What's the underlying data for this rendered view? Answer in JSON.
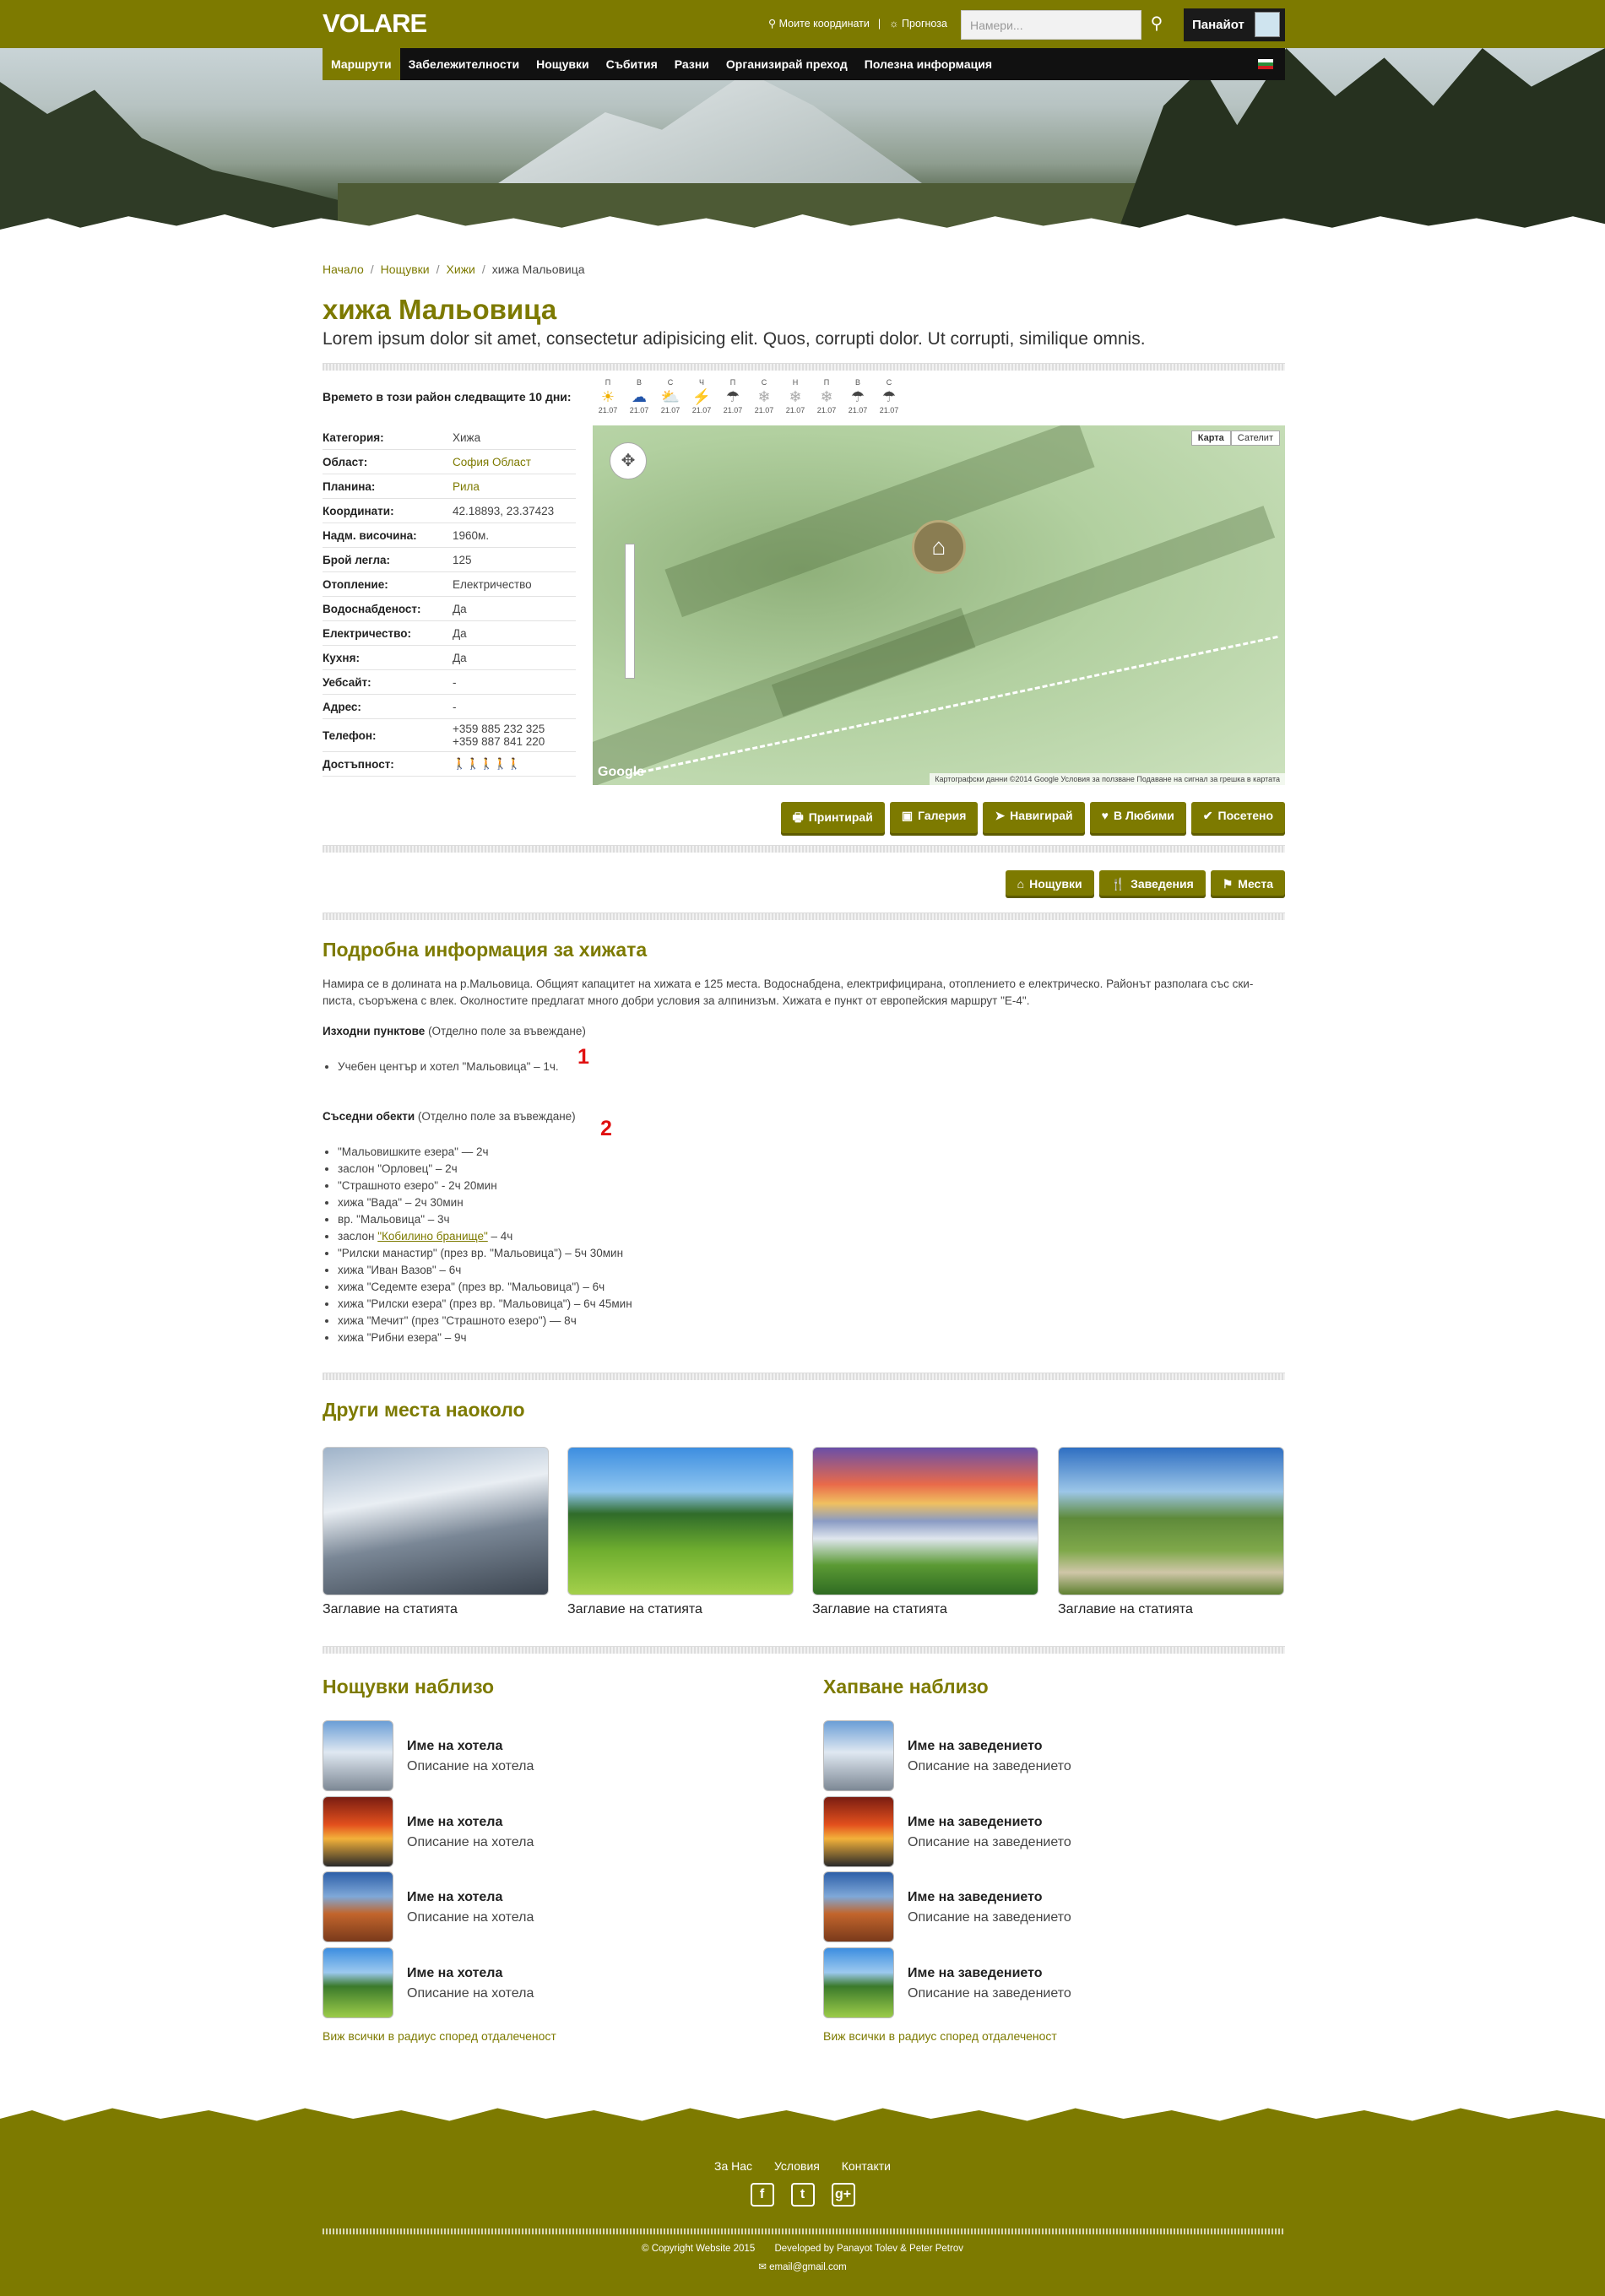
{
  "header": {
    "logo": "VOLARE",
    "my_coords": "⚲ Моите координати",
    "forecast": "☼ Прогноза",
    "separator": "|",
    "search_placeholder": "Намери...",
    "user_name": "Панайот"
  },
  "nav": {
    "items": [
      {
        "label": "Маршрути",
        "active": true
      },
      {
        "label": "Забележителности",
        "active": false
      },
      {
        "label": "Нощувки",
        "active": false
      },
      {
        "label": "Събития",
        "active": false
      },
      {
        "label": "Разни",
        "active": false
      },
      {
        "label": "Организирай преход",
        "active": false
      },
      {
        "label": "Полезна информация",
        "active": false
      }
    ]
  },
  "breadcrumb": [
    "Начало",
    "Нощувки",
    "Хижи",
    "хижа Мальовица"
  ],
  "page": {
    "title": "хижа Мальовица",
    "subtitle": "Lorem ipsum dolor sit amet, consectetur adipisicing elit. Quos, corrupti dolor. Ut corrupti, similique omnis."
  },
  "weather": {
    "label": "Времето в този район следващите 10 дни:",
    "days": [
      {
        "day": "П",
        "icon": "sun-icon",
        "glyph": "☀",
        "color": "#f0b000",
        "date": "21.07"
      },
      {
        "day": "В",
        "icon": "cloud-icon",
        "glyph": "☁",
        "color": "#2255aa",
        "date": "21.07"
      },
      {
        "day": "С",
        "icon": "sun-cloud-icon",
        "glyph": "⛅",
        "color": "#33aacc",
        "date": "21.07"
      },
      {
        "day": "Ч",
        "icon": "lightning-icon",
        "glyph": "⚡",
        "color": "#dd1111",
        "date": "21.07"
      },
      {
        "day": "П",
        "icon": "rain-icon",
        "glyph": "☂",
        "color": "#444444",
        "date": "21.07"
      },
      {
        "day": "С",
        "icon": "snow-icon",
        "glyph": "❄",
        "color": "#aaaaaa",
        "date": "21.07"
      },
      {
        "day": "Н",
        "icon": "snow-icon",
        "glyph": "❄",
        "color": "#aaaaaa",
        "date": "21.07"
      },
      {
        "day": "П",
        "icon": "snow-icon",
        "glyph": "❄",
        "color": "#aaaaaa",
        "date": "21.07"
      },
      {
        "day": "В",
        "icon": "rain-icon",
        "glyph": "☂",
        "color": "#444444",
        "date": "21.07"
      },
      {
        "day": "С",
        "icon": "rain-icon",
        "glyph": "☂",
        "color": "#444444",
        "date": "21.07"
      }
    ]
  },
  "properties": [
    {
      "k": "Категория:",
      "v": "Хижа"
    },
    {
      "k": "Област:",
      "v": "София Област",
      "link": true
    },
    {
      "k": "Планина:",
      "v": "Рила",
      "link": true
    },
    {
      "k": "Координати:",
      "v": "42.18893, 23.37423"
    },
    {
      "k": "Надм. височина:",
      "v": "1960м."
    },
    {
      "k": "Брой легла:",
      "v": "125"
    },
    {
      "k": "Отопление:",
      "v": "Електричество"
    },
    {
      "k": "Водоснабденост:",
      "v": "Да"
    },
    {
      "k": "Електричество:",
      "v": "Да"
    },
    {
      "k": "Кухня:",
      "v": "Да"
    },
    {
      "k": "Уебсайт:",
      "v": "-"
    },
    {
      "k": "Адрес:",
      "v": "-"
    },
    {
      "k": "Телефон:",
      "v": "+359 885 232 325\n+359 887 841 220"
    },
    {
      "k": "Достъпност:",
      "v": ""
    }
  ],
  "accessibility_rating": 4,
  "accessibility_max": 5,
  "map": {
    "tab_map": "Карта",
    "tab_sat": "Сателит",
    "google": "Google",
    "footer": "Картографски данни ©2014 Google   Условия за ползване   Подаване на сигнал за грешка в картата"
  },
  "actions": [
    "Принтирай",
    "Галерия",
    "Навигирай",
    "В Любими",
    "Посетено"
  ],
  "action_icons": [
    "🖶",
    "▣",
    "➤",
    "♥",
    "✔"
  ],
  "filters": [
    "Нощувки",
    "Заведения",
    "Места"
  ],
  "filter_icons": [
    "⌂",
    "🍴",
    "⚑"
  ],
  "info": {
    "heading": "Подробна информация за хижата",
    "text": "Намира се в долината на р.Мальовица. Общият капацитет на хижата е 125 места. Водоснабдена, електрифицирана, отоплението е електрическо. Районът разполага със ски-писта, съоръжена с влек. Околностите предлагат много добри условия за алпинизъм. Хижата е пункт от европейския маршрут \"Е-4\".",
    "start_label": "Изходни пунктове",
    "start_note": " (Отделно поле за въвеждане)",
    "start_items": [
      "Учебен център и хотел \"Мальовица\" – 1ч."
    ],
    "neighbors_label": "Съседни обекти",
    "neighbors_note": " (Отделно поле за въвеждане)",
    "neighbors": [
      "\"Мальовишките езера\" — 2ч",
      "заслон \"Орловец\" – 2ч",
      "\"Страшното езеро\" - 2ч 20мин",
      "хижа \"Вада\" – 2ч 30мин",
      "вр. \"Мальовица\" – 3ч",
      "заслон ",
      "\"Рилски манастир\" (през вр. \"Мальовица\") – 5ч 30мин",
      "хижа \"Иван Вазов\" – 6ч",
      "хижа \"Седемте езера\" (през вр. \"Мальовица\") – 6ч",
      "хижа \"Рилски езера\" (през вр. \"Мальовица\") – 6ч 45мин",
      "хижа \"Мечит\" (през \"Страшното езеро\") — 8ч",
      "хижа \"Рибни езера\" – 9ч"
    ],
    "neighbor_link": "\"Кобилино бранище\"",
    "neighbor_link_tail": " – 4ч",
    "marker1": "1",
    "marker2": "2"
  },
  "other": {
    "heading": "Други места наоколо",
    "cards": [
      "Заглавие на статията",
      "Заглавие на статията",
      "Заглавие на статията",
      "Заглавие на статията"
    ]
  },
  "lodging": {
    "heading": "Нощувки наблизо",
    "items": [
      {
        "t": "Име на хотела",
        "d": "Описание на хотела"
      },
      {
        "t": "Име на хотела",
        "d": "Описание на хотела"
      },
      {
        "t": "Име на хотела",
        "d": "Описание на хотела"
      },
      {
        "t": "Име на хотела",
        "d": "Описание на хотела"
      }
    ],
    "see_all": "Виж всички в радиус според отдалеченост"
  },
  "food": {
    "heading": "Хапване наблизо",
    "items": [
      {
        "t": "Име на заведението",
        "d": "Описание на заведението"
      },
      {
        "t": "Име на заведението",
        "d": "Описание на заведението"
      },
      {
        "t": "Име на заведението",
        "d": "Описание на заведението"
      },
      {
        "t": "Име на заведението",
        "d": "Описание на заведението"
      }
    ],
    "see_all": "Виж всички в радиус според отдалеченост"
  },
  "footer": {
    "links": [
      "За Нас",
      "Условия",
      "Контакти"
    ],
    "social": [
      "f",
      "t",
      "g+"
    ],
    "copyright": "© Copyright Website 2015",
    "developed": "Developed by Panayot Tolev & Peter Petrov",
    "email": "✉ email@gmail.com"
  },
  "colors": {
    "accent": "#7d7a00",
    "dark": "#111111"
  }
}
